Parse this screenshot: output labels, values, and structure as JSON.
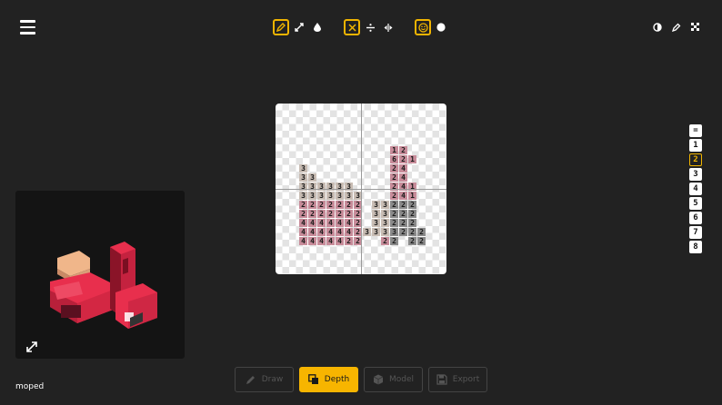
{
  "toolbar": {
    "menu_icon": "hamburger-icon",
    "tools": [
      "pencil-icon",
      "resize-icon",
      "droplet-icon",
      "close-icon",
      "divide-icon",
      "split-icon",
      "smile-icon",
      "circle-icon"
    ],
    "right_tools": [
      "contrast-icon",
      "eyedropper-icon",
      "checker-icon"
    ],
    "accent": "#f0b400"
  },
  "canvas": {
    "palette": {
      "1": "#c88c9a",
      "2": "#c88c9a",
      "3": "#c9bdb4",
      "4": "#c88c9a",
      "6": "#c88c9a",
      "g": "#8a8a8a"
    },
    "rows": [
      "          12",
      "          621",
      "3         24",
      "33        24",
      "333333    241",
      "3333333   241",
      "2222222 33222",
      "2222222 33222",
      "4444442 33222",
      "44444423333222",
      "4444422  22 22"
    ]
  },
  "preview": {
    "expand_icon": "expand-icon",
    "model_name": "moped"
  },
  "layers": {
    "items": [
      "=",
      "1",
      "2",
      "3",
      "4",
      "5",
      "6",
      "7",
      "8"
    ],
    "active": "2"
  },
  "modes": {
    "items": [
      {
        "label": "Draw",
        "icon": "pencil-icon",
        "state": "disabled"
      },
      {
        "label": "Depth",
        "icon": "depth-icon",
        "state": "active"
      },
      {
        "label": "Model",
        "icon": "cube-icon",
        "state": "disabled"
      },
      {
        "label": "Export",
        "icon": "save-icon",
        "state": "disabled"
      }
    ]
  }
}
